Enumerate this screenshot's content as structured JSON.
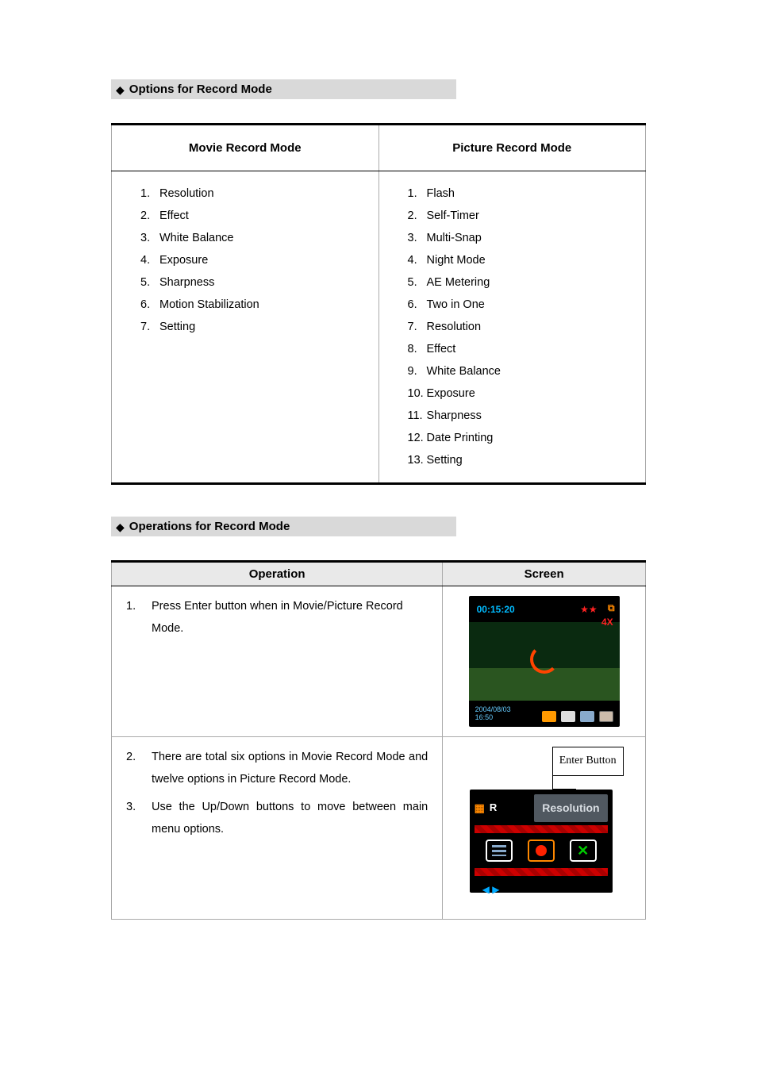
{
  "sections": {
    "options_title": "Options for Record Mode",
    "operations_title": "Operations for Record Mode"
  },
  "options_table": {
    "headers": {
      "movie": "Movie Record Mode",
      "picture": "Picture Record Mode"
    },
    "movie_items": [
      "Resolution",
      "Effect",
      "White Balance",
      "Exposure",
      "Sharpness",
      "Motion Stabilization",
      "Setting"
    ],
    "picture_items": [
      "Flash",
      "Self-Timer",
      "Multi-Snap",
      "Night Mode",
      "AE Metering",
      "Two in One",
      "Resolution",
      "Effect",
      "White Balance",
      "Exposure",
      "Sharpness",
      "Date Printing",
      "Setting"
    ]
  },
  "ops_table": {
    "headers": {
      "operation": "Operation",
      "screen": "Screen"
    },
    "rows": [
      {
        "steps": [
          {
            "n": "1.",
            "text": "Press Enter button when in Movie/Picture Record Mode."
          }
        ]
      },
      {
        "steps": [
          {
            "n": "2.",
            "text": "There are total six options in Movie Record Mode and twelve options in Picture Record Mode."
          },
          {
            "n": "3.",
            "text": "Use the Up/Down buttons to move between main menu options."
          }
        ]
      }
    ]
  },
  "screen1": {
    "time": "00:15:20",
    "stars": "★★",
    "res_icon": "⧉",
    "zoom": "4X",
    "date_line1": "2004/08/03",
    "date_line2": "16:50"
  },
  "screen2": {
    "enter_button_label": "Enter Button",
    "r_label": "R",
    "resolution_label": "Resolution",
    "arrows": "◀ ▶"
  }
}
